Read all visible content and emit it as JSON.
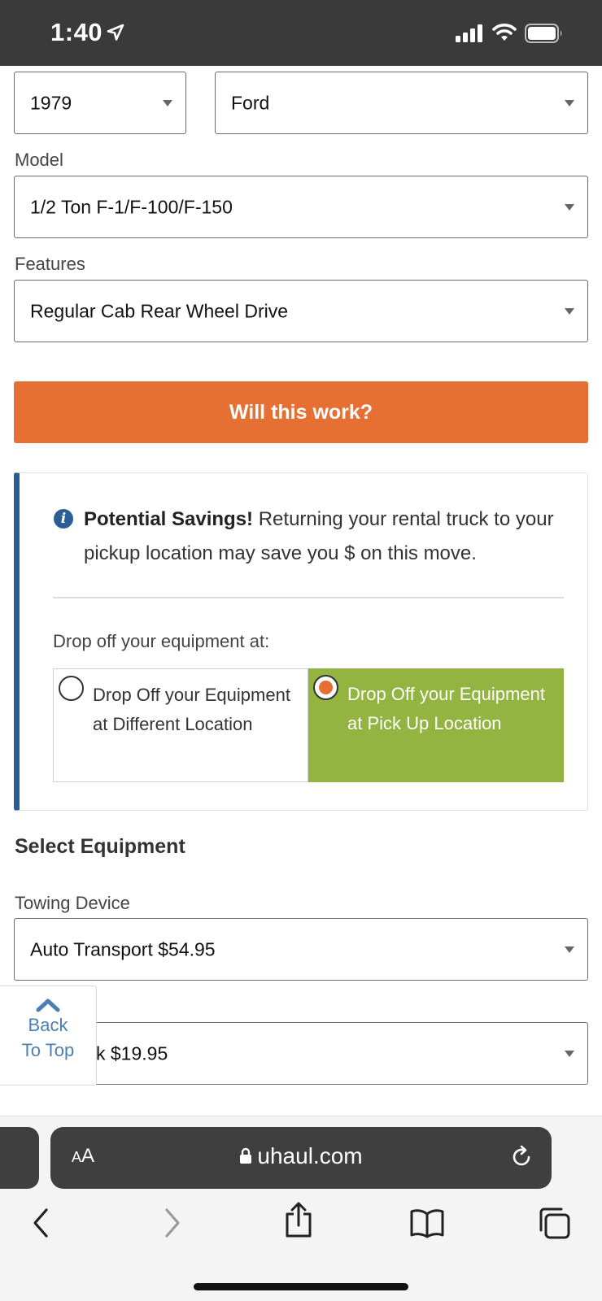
{
  "status_bar": {
    "time": "1:40"
  },
  "vehicle": {
    "year_value": "1979",
    "make_value": "Ford",
    "model_label": "Model",
    "model_value": "1/2 Ton F-1/F-100/F-150",
    "features_label": "Features",
    "features_value": "Regular Cab Rear Wheel Drive",
    "check_button": "Will this work?"
  },
  "savings": {
    "headline": "Potential Savings!",
    "message": "Returning your rental truck to your pickup location may save you $ on this move.",
    "drop_label": "Drop off your equipment at:",
    "option_different": "Drop Off your Equipment at Different Location",
    "option_pickup": "Drop Off your Equipment at Pick Up Location",
    "selected": "option_pickup"
  },
  "equipment": {
    "title": "Select Equipment",
    "towing_label": "Towing Device",
    "towing_value": "Auto Transport $54.95",
    "second_value": "k $19.95"
  },
  "back_to_top": {
    "line1": "Back",
    "line2": "To Top"
  },
  "browser": {
    "aa": "AA",
    "url": "uhaul.com"
  },
  "colors": {
    "accent_orange": "#e67034",
    "selected_green": "#93b440",
    "info_blue": "#2c5e96",
    "link_blue": "#4d7fb5"
  }
}
